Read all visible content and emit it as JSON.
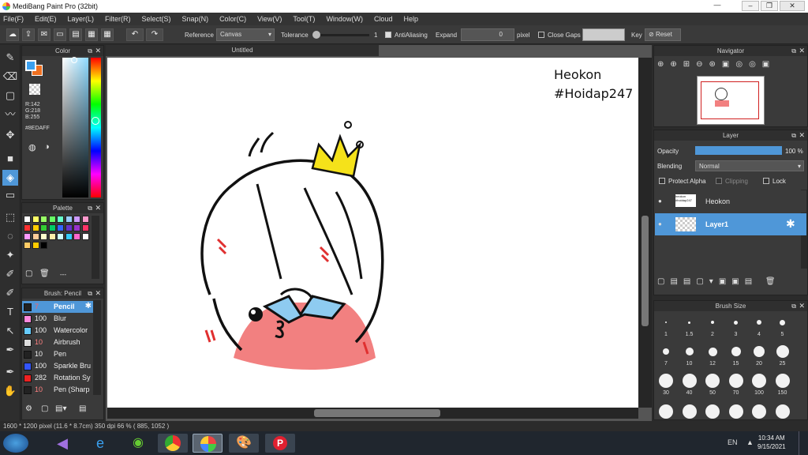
{
  "window": {
    "title": "MediBang Paint Pro (32bit)"
  },
  "menu": [
    "File(F)",
    "Edit(E)",
    "Layer(L)",
    "Filter(R)",
    "Select(S)",
    "Snap(N)",
    "Color(C)",
    "View(V)",
    "Tool(T)",
    "Window(W)",
    "Cloud",
    "Help"
  ],
  "options": {
    "reference_label": "Reference",
    "reference_value": "Canvas",
    "tolerance_label": "Tolerance",
    "tolerance_value": "1",
    "antialias_label": "AntiAliasing",
    "expand_label": "Expand",
    "expand_value": "0",
    "expand_unit": "pixel",
    "close_gaps_label": "Close Gaps",
    "key_label": "Key",
    "reset_label": "Reset"
  },
  "color_panel": {
    "title": "Color",
    "r": "R:142",
    "g": "G:218",
    "b": "B:255",
    "hex": "#8EDAFF",
    "primary": "#3aa0f0",
    "secondary": "#f07020"
  },
  "palette_panel": {
    "title": "Palette",
    "label": "---",
    "swatches": [
      "#ffffff",
      "#ffff66",
      "#99ff66",
      "#66ff66",
      "#66ffcc",
      "#99ccff",
      "#cc99ff",
      "#ff99cc",
      "#ff3333",
      "#ffcc00",
      "#33cc33",
      "#00cc66",
      "#3366ff",
      "#6633cc",
      "#9933cc",
      "#ff3366",
      "#ff99ff",
      "#ffcc99",
      "#ffffcc",
      "#ffeeaa",
      "#ccffff",
      "#33ccff",
      "#ff66cc",
      "#ffffff",
      "#ffcc66",
      "#ffcc00",
      "#000000"
    ]
  },
  "brush_panel": {
    "title": "Brush: Pencil",
    "items": [
      {
        "size": "7",
        "name": "Pencil",
        "color": "#222222"
      },
      {
        "size": "100",
        "name": "Blur",
        "color": "#ff88dd"
      },
      {
        "size": "100",
        "name": "Watercolor",
        "color": "#66ccff"
      },
      {
        "size": "10",
        "name": "Airbrush",
        "color": "#dddddd"
      },
      {
        "size": "10",
        "name": "Pen",
        "color": "#222222"
      },
      {
        "size": "100",
        "name": "Sparkle Bru",
        "color": "#3355ff"
      },
      {
        "size": "282",
        "name": "Rotation Sy",
        "color": "#ee2222"
      },
      {
        "size": "10",
        "name": "Pen (Sharp",
        "color": "#222222"
      }
    ]
  },
  "canvas": {
    "tab": "Untitled",
    "text_line1": "Heokon",
    "text_line2": "#Hoidap247"
  },
  "navigator": {
    "title": "Navigator"
  },
  "layer_panel": {
    "title": "Layer",
    "opacity_label": "Opacity",
    "opacity_value": "100 %",
    "opacity": 1.0,
    "blending_label": "Blending",
    "blending_value": "Normal",
    "protect_alpha": "Protect Alpha",
    "clipping": "Clipping",
    "lock": "Lock",
    "layers": [
      {
        "name": "Heokon",
        "thumb_text": "heokon #hoidap247"
      },
      {
        "name": "Layer1"
      }
    ]
  },
  "brush_size_panel": {
    "title": "Brush Size",
    "sizes": [
      "1",
      "1.5",
      "2",
      "3",
      "4",
      "5",
      "7",
      "10",
      "12",
      "15",
      "20",
      "25",
      "30",
      "40",
      "50",
      "70",
      "100",
      "150"
    ]
  },
  "status": {
    "text": "1600 * 1200 pixel  (11.6 * 8.7cm)  350 dpi  66 %  ( 885, 1052 )"
  },
  "taskbar": {
    "lang": "EN",
    "time": "10:34 AM",
    "date": "9/15/2021"
  }
}
